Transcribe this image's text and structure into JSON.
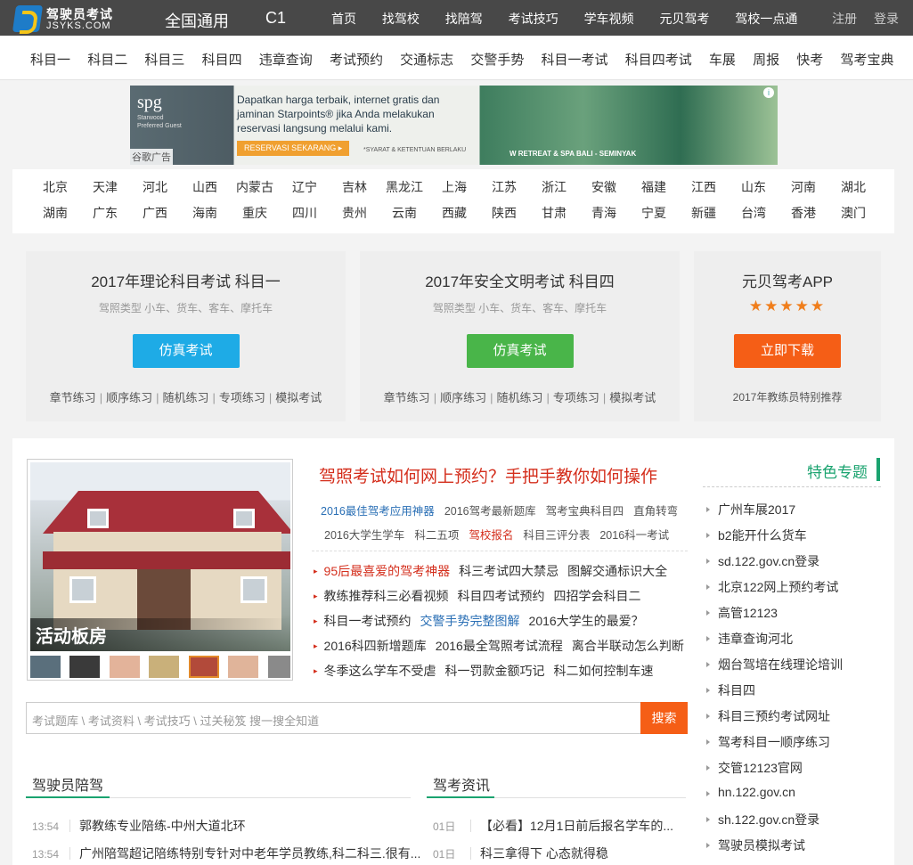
{
  "brand": {
    "name_cn": "驾驶员考试",
    "name_en": "JSYKS.COM"
  },
  "top": {
    "region": "全国通用",
    "license_class": "C1",
    "nav": [
      "首页",
      "找驾校",
      "找陪驾",
      "考试技巧",
      "学车视频",
      "元贝驾考",
      "驾校一点通"
    ],
    "register": "注册",
    "login": "登录"
  },
  "subnav": [
    "科目一",
    "科目二",
    "科目三",
    "科目四",
    "违章查询",
    "考试预约",
    "交通标志",
    "交警手势",
    "科目一考试",
    "科目四考试",
    "车展",
    "周报",
    "快考",
    "驾考宝典"
  ],
  "ad": {
    "brand": "spg",
    "brand_sub": "Starwood Preferred Guest",
    "text": "Dapatkan harga terbaik, internet gratis dan jaminan Starpoints® jika Anda melakukan reservasi langsung melalui kami.",
    "cta": "RESERVASI SEKARANG ▸",
    "terms": "*SYARAT & KETENTUAN BERLAKU",
    "place": "W RETREAT & SPA BALI - SEMINYAK",
    "label": "谷歌广告",
    "info": "i"
  },
  "cities": [
    "北京",
    "天津",
    "河北",
    "山西",
    "内蒙古",
    "辽宁",
    "吉林",
    "黑龙江",
    "上海",
    "江苏",
    "浙江",
    "安徽",
    "福建",
    "江西",
    "山东",
    "河南",
    "湖北",
    "湖南",
    "广东",
    "广西",
    "海南",
    "重庆",
    "四川",
    "贵州",
    "云南",
    "西藏",
    "陕西",
    "甘肃",
    "青海",
    "宁夏",
    "新疆",
    "台湾",
    "香港",
    "澳门"
  ],
  "panels": {
    "p1": {
      "title": "2017年理论科目考试 科目一",
      "sub": "驾照类型 小车、货车、客车、摩托车",
      "button": "仿真考试",
      "links": [
        "章节练习",
        "顺序练习",
        "随机练习",
        "专项练习",
        "模拟考试"
      ]
    },
    "p2": {
      "title": "2017年安全文明考试 科目四",
      "sub": "驾照类型 小车、货车、客车、摩托车",
      "button": "仿真考试",
      "links": [
        "章节练习",
        "顺序练习",
        "随机练习",
        "专项练习",
        "模拟考试"
      ]
    },
    "p3": {
      "title": "元贝驾考APP",
      "stars": "★★★★★",
      "button": "立即下载",
      "note": "2017年教练员特别推荐"
    }
  },
  "feature_photo": {
    "caption": "活动板房"
  },
  "headline": "驾照考试如何网上预约？手把手教你如何操作",
  "tags_row1": [
    "2016最佳驾考应用神器",
    "2016驾考最新题库",
    "驾考宝典科目四",
    "直角转弯"
  ],
  "tags_row2": [
    "2016大学生学车",
    "科二五项",
    "驾校报名",
    "科目三评分表",
    "2016科一考试"
  ],
  "news_rows": [
    [
      "95后最喜爱的驾考神器",
      "科三考试四大禁忌",
      "图解交通标识大全"
    ],
    [
      "教练推荐科三必看视频",
      "科目四考试预约",
      "四招学会科目二"
    ],
    [
      "科目一考试预约",
      "交警手势完整图解",
      "2016大学生的最爱？"
    ],
    [
      "2016科四新增题库",
      "2016最全驾照考试流程",
      "离合半联动怎么判断"
    ],
    [
      "冬季这么学车不受虐",
      "科一罚款金额巧记",
      "科二如何控制车速"
    ]
  ],
  "search": {
    "placeholder": "考试题库 \\ 考试资料 \\ 考试技巧 \\ 过关秘笈    搜一搜全知道",
    "button": "搜索"
  },
  "features": {
    "title": "特色专题",
    "items": [
      "广州车展2017",
      "b2能开什么货车",
      "sd.122.gov.cn登录",
      "北京122网上预约考试",
      "高管12123",
      "违章查询河北",
      "烟台驾培在线理论培训",
      "科目四",
      "科目三预约考试网址",
      "驾考科目一顺序练习",
      "交管12123官网",
      "hn.122.gov.cn",
      "sh.122.gov.cn登录",
      "驾驶员模拟考试"
    ]
  },
  "peijia": {
    "title": "驾驶员陪驾",
    "items": [
      {
        "time": "13:54",
        "text": "郭教练专业陪练-中州大道北环"
      },
      {
        "time": "13:54",
        "text": "广州陪驾超记陪练特别专针对中老年学员教练,科二科三.很有..."
      }
    ]
  },
  "news": {
    "title": "驾考资讯",
    "items": [
      {
        "time": "01日",
        "text": "【必看】12月1日前后报名学车的..."
      },
      {
        "time": "01日",
        "text": "科三拿得下 心态就得稳"
      }
    ]
  },
  "colors": {
    "accent_green": "#1aa36f",
    "accent_red": "#d42e1c",
    "btn_blue": "#1eabe6",
    "btn_green": "#49b549",
    "btn_orange": "#f55e16",
    "topbar": "#484848"
  }
}
